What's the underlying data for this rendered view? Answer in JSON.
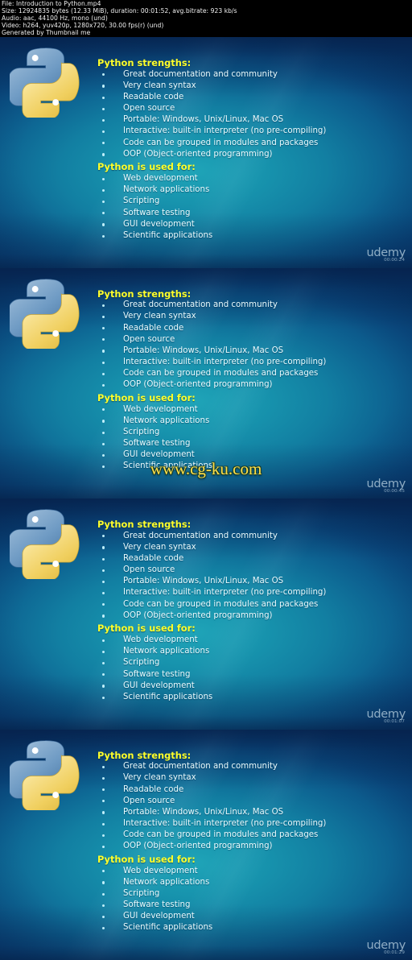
{
  "header": {
    "lines": [
      "File: Introduction to Python.mp4",
      "Size: 12924835 bytes (12.33 MiB), duration: 00:01:52, avg.bitrate: 923 kb/s",
      "Audio: aac, 44100 Hz, mono (und)",
      "Video: h264, yuv420p, 1280x720, 30.00 fps(r) (und)",
      "Generated by Thumbnail me"
    ]
  },
  "slide": {
    "strengths_heading": "Python strengths:",
    "strengths": [
      "Great documentation and community",
      "Very clean syntax",
      "Readable code",
      "Open source",
      "Portable: Windows, Unix/Linux, Mac OS",
      "Interactive: built-in interpreter (no pre-compiling)",
      "Code can be grouped in modules and packages",
      "OOP (Object-oriented programming)"
    ],
    "used_for_heading": "Python is used for:",
    "used_for": [
      "Web development",
      "Network applications",
      "Scripting",
      "Software testing",
      "GUI development",
      "Scientific applications"
    ]
  },
  "watermarks": {
    "brand": "udemy",
    "site": "www.cg-ku.com"
  },
  "frames": [
    {
      "timestamp": "00:00:24",
      "has_site_watermark": false
    },
    {
      "timestamp": "00:00:45",
      "has_site_watermark": true
    },
    {
      "timestamp": "00:01:07",
      "has_site_watermark": false
    },
    {
      "timestamp": "00:01:29",
      "has_site_watermark": false
    }
  ],
  "colors": {
    "heading": "#ffff2a",
    "body_text": "#eafcff",
    "background_teal": "#1fa4b8",
    "background_deep": "#073a6e",
    "site_watermark": "#ffe04a",
    "python_blue": "#5a89b8",
    "python_yellow": "#f5d964"
  }
}
